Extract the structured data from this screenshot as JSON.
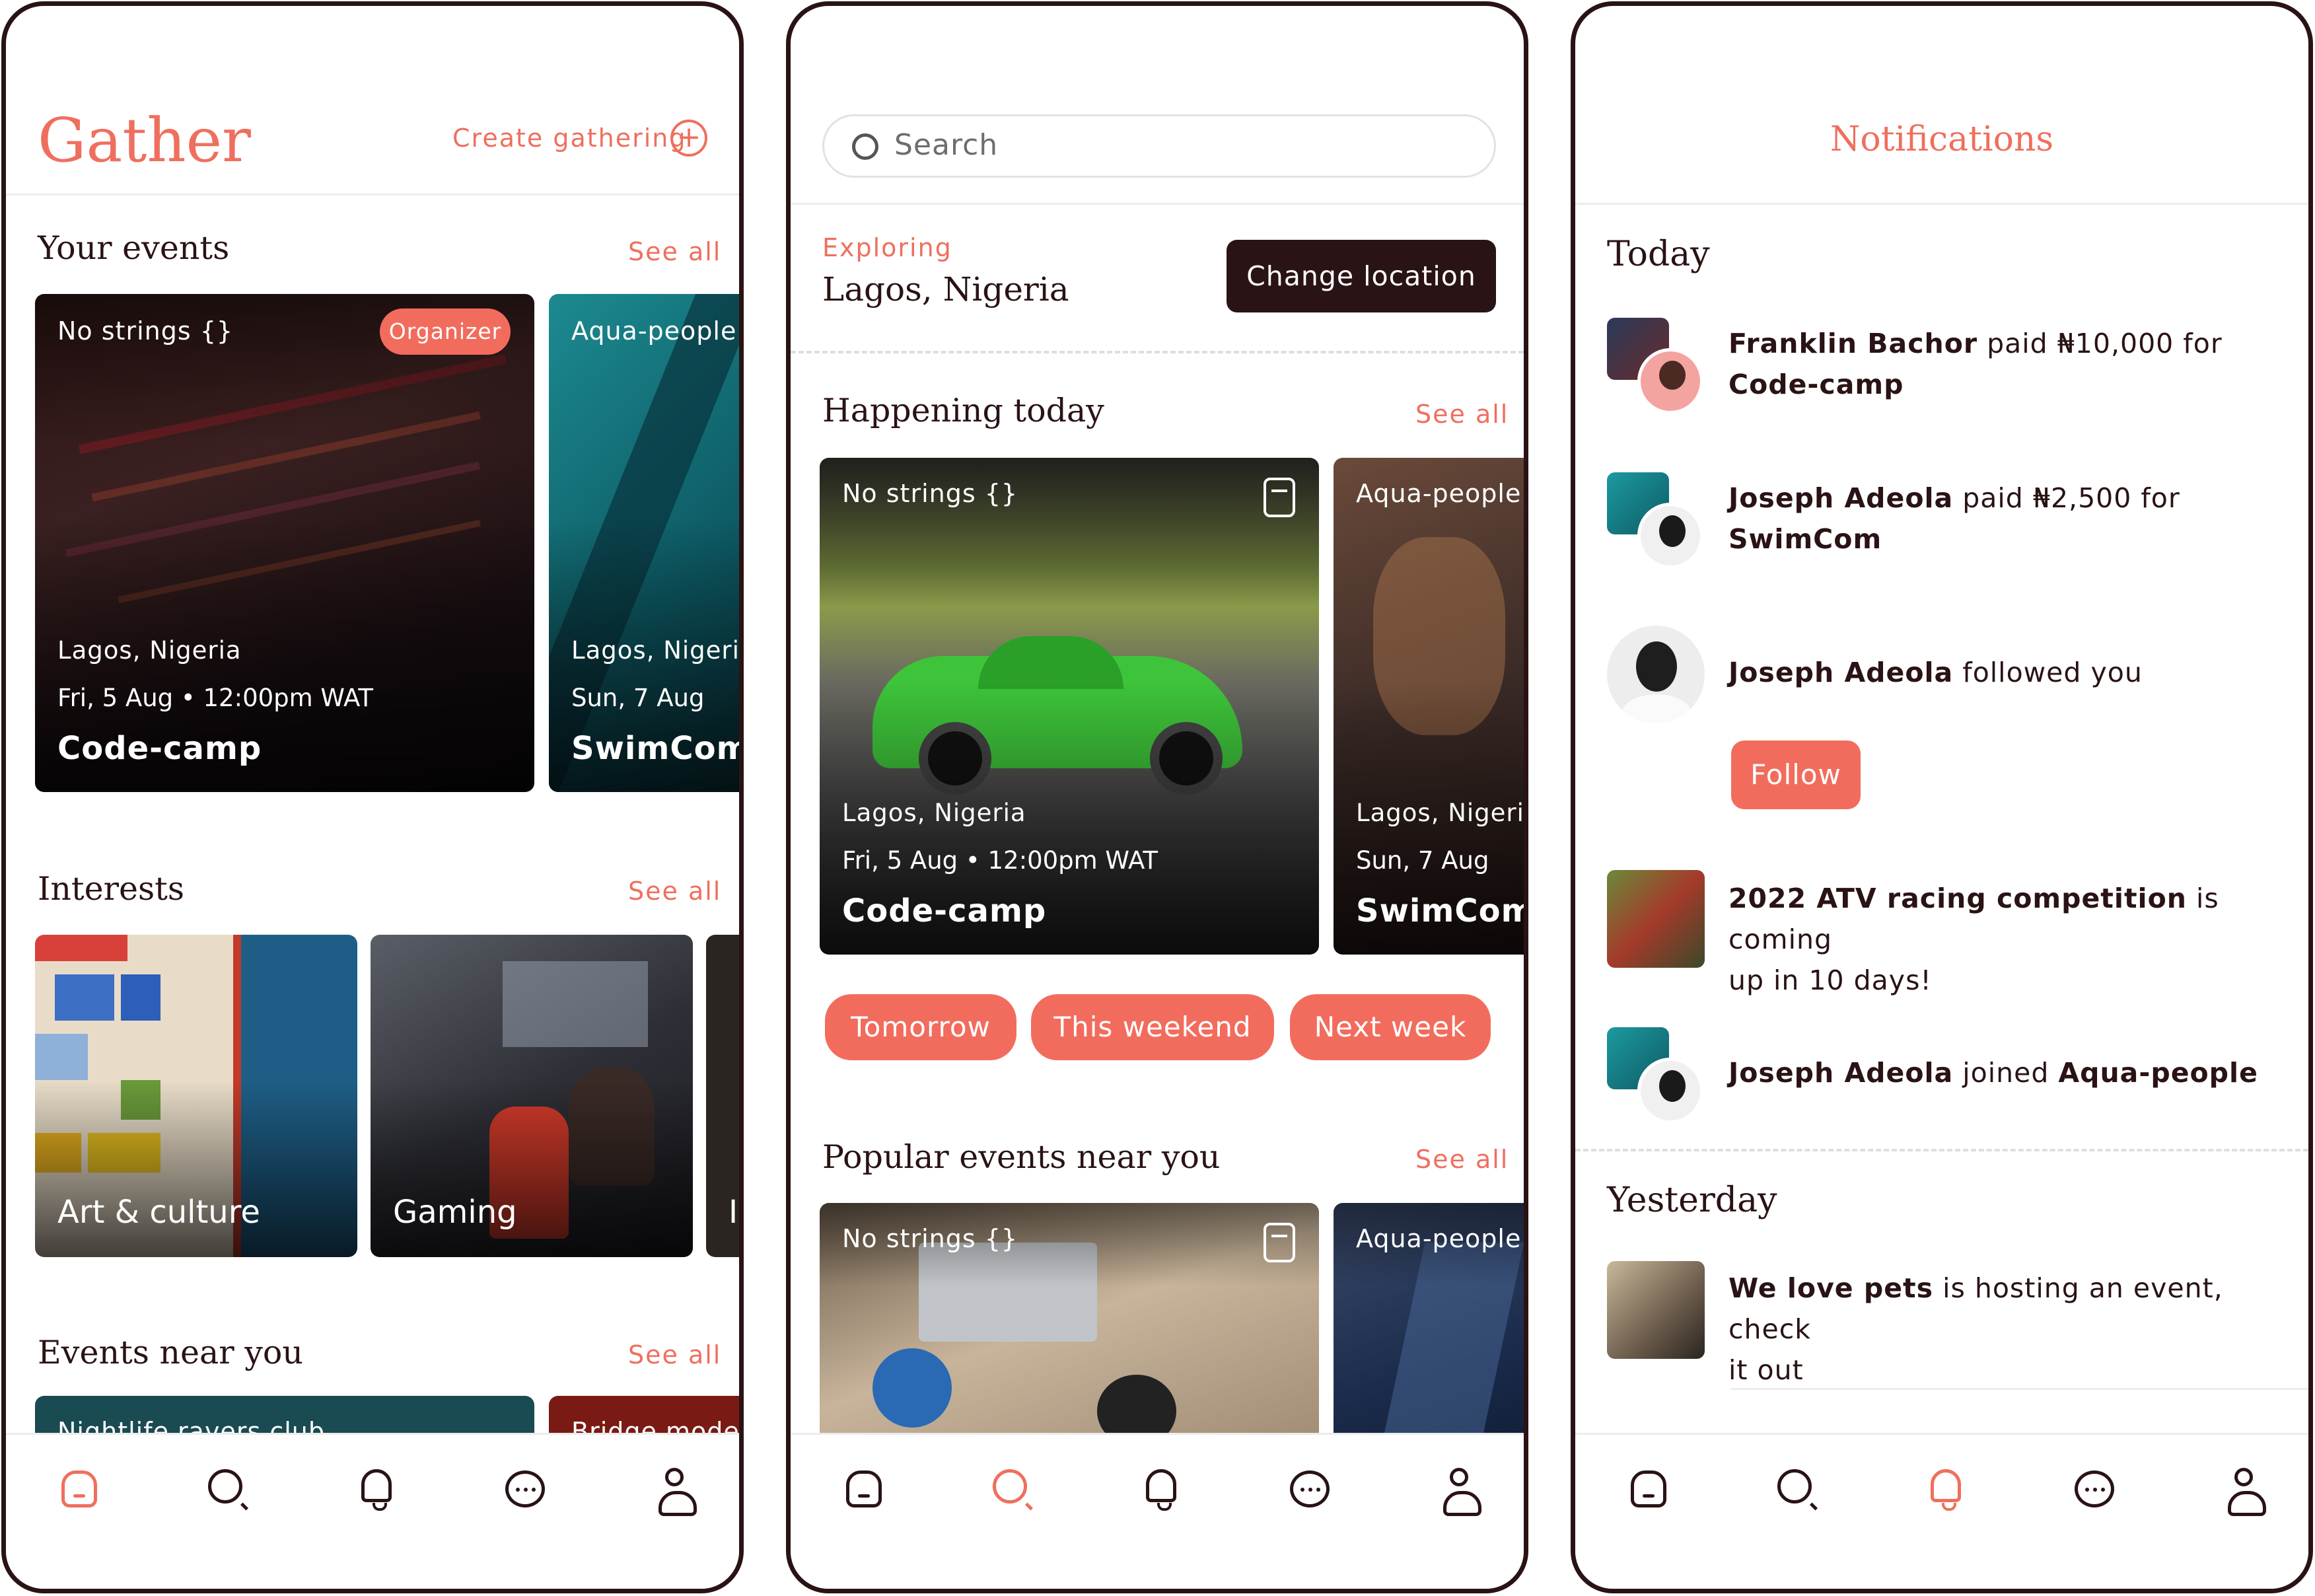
{
  "colors": {
    "accent": "#ef6f5e",
    "dark": "#2a1314",
    "divider": "#ececec"
  },
  "screen1": {
    "app_title": "Gather",
    "create_label": "Create gathering",
    "your_events": {
      "title": "Your events",
      "see_all": "See all",
      "cards": [
        {
          "group": "No strings {}",
          "badge": "Organizer",
          "location": "Lagos, Nigeria",
          "date": "Fri, 5 Aug",
          "time": "12:00pm WAT",
          "name": "Code-camp"
        },
        {
          "group": "Aqua-people",
          "location": "Lagos, Nigeria",
          "date": "Sun, 7 Aug",
          "name": "SwimCom"
        }
      ]
    },
    "interests": {
      "title": "Interests",
      "see_all": "See all",
      "items": [
        "Art & culture",
        "Gaming",
        "I"
      ]
    },
    "events_near": {
      "title": "Events near you",
      "see_all": "See all",
      "cards": [
        "Nightlife ravers club",
        "Bridge models"
      ]
    }
  },
  "screen2": {
    "search_placeholder": "Search",
    "exploring_label": "Exploring",
    "location": "Lagos, Nigeria",
    "change_location": "Change location",
    "happening": {
      "title": "Happening today",
      "see_all": "See all",
      "cards": [
        {
          "group": "No strings {}",
          "location": "Lagos, Nigeria",
          "date": "Fri, 5 Aug",
          "time": "12:00pm WAT",
          "name": "Code-camp"
        },
        {
          "group": "Aqua-people",
          "location": "Lagos, Nigeria",
          "date": "Sun, 7 Aug",
          "name": "SwimCom"
        }
      ]
    },
    "filters": [
      "Tomorrow",
      "This weekend",
      "Next week"
    ],
    "popular": {
      "title": "Popular events near you",
      "see_all": "See all",
      "cards": [
        {
          "group": "No strings {}"
        },
        {
          "group": "Aqua-people"
        }
      ]
    }
  },
  "screen3": {
    "title": "Notifications",
    "today_label": "Today",
    "yesterday_label": "Yesterday",
    "n1": {
      "name": "Franklin Bachor",
      "mid": " paid ₦10,000 for",
      "target": "Code-camp"
    },
    "n2": {
      "name": "Joseph Adeola",
      "mid": " paid ₦2,500 for",
      "target": "SwimCom"
    },
    "n3": {
      "name": "Joseph Adeola",
      "mid": " followed you",
      "follow_label": "Follow"
    },
    "n4": {
      "name": "2022 ATV racing competition",
      "mid": " is coming",
      "line2": "up in 10 days!"
    },
    "n5": {
      "name": "Joseph Adeola",
      "mid": " joined ",
      "target": "Aqua-people"
    },
    "n6": {
      "name": "We love pets",
      "mid": " is hosting an event, check",
      "line2": "it out"
    }
  },
  "nav": [
    "home-icon",
    "search-icon",
    "bell-icon",
    "chat-icon",
    "user-icon"
  ]
}
